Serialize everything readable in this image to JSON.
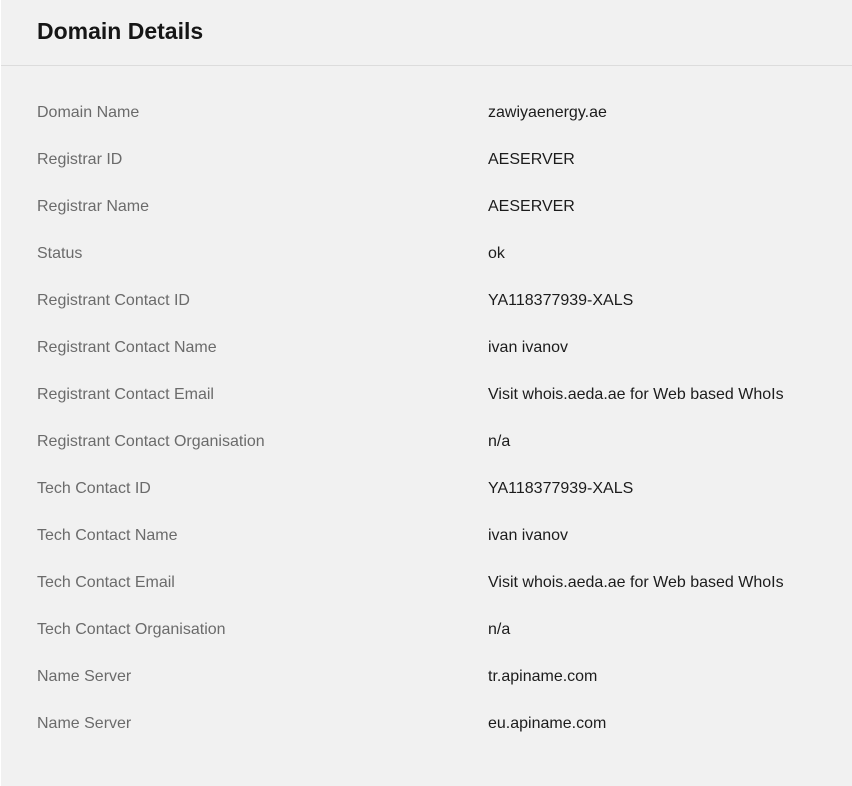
{
  "header": {
    "title": "Domain Details"
  },
  "details": [
    {
      "label": "Domain Name",
      "value": "zawiyaenergy.ae"
    },
    {
      "label": "Registrar ID",
      "value": "AESERVER"
    },
    {
      "label": "Registrar Name",
      "value": "AESERVER"
    },
    {
      "label": "Status",
      "value": "ok"
    },
    {
      "label": "Registrant Contact ID",
      "value": "YA118377939-XALS"
    },
    {
      "label": "Registrant Contact Name",
      "value": "ivan ivanov"
    },
    {
      "label": "Registrant Contact Email",
      "value": "Visit whois.aeda.ae for Web based WhoIs"
    },
    {
      "label": "Registrant Contact Organisation",
      "value": "n/a"
    },
    {
      "label": "Tech Contact ID",
      "value": "YA118377939-XALS"
    },
    {
      "label": "Tech Contact Name",
      "value": "ivan ivanov"
    },
    {
      "label": "Tech Contact Email",
      "value": "Visit whois.aeda.ae for Web based WhoIs"
    },
    {
      "label": "Tech Contact Organisation",
      "value": "n/a"
    },
    {
      "label": "Name Server",
      "value": "tr.apiname.com"
    },
    {
      "label": "Name Server",
      "value": "eu.apiname.com"
    }
  ]
}
